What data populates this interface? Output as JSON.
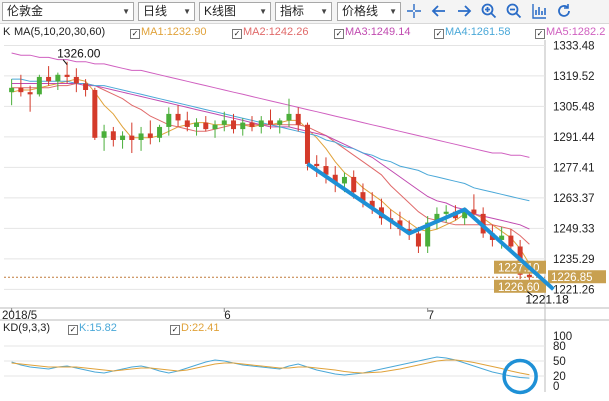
{
  "toolbar": {
    "symbol": "伦敦金",
    "period": "日线",
    "chart_type": "K线图",
    "indicator": "指标",
    "price_line": "价格线",
    "icons": [
      "crosshair-icon",
      "arrow-left-icon",
      "arrow-right-icon",
      "zoom-in-icon",
      "zoom-out-icon",
      "bar-chart-icon",
      "refresh-icon"
    ]
  },
  "ma_legend": {
    "label": "K",
    "params": "MA(5,10,20,30,60)",
    "items": [
      {
        "name": "MA1",
        "value": "1232.90",
        "color": "#e0a23a"
      },
      {
        "name": "MA2",
        "value": "1242.26",
        "color": "#e06a6a"
      },
      {
        "name": "MA3",
        "value": "1249.14",
        "color": "#c04ab0"
      },
      {
        "name": "MA4",
        "value": "1261.58",
        "color": "#4aa8d8"
      },
      {
        "name": "MA5",
        "value": "1282.2",
        "color": "#d060c0"
      }
    ]
  },
  "price_axis": {
    "ticks": [
      "1333.48",
      "1319.52",
      "1305.48",
      "1291.44",
      "1277.41",
      "1263.37",
      "1249.33",
      "1235.29",
      "1221.26"
    ],
    "tick_values": [
      1333.48,
      1319.52,
      1305.48,
      1291.44,
      1277.41,
      1263.37,
      1249.33,
      1235.29,
      1221.26
    ],
    "tags": [
      "1227.10",
      "1226.85",
      "1226.60"
    ],
    "tag_values": [
      1227.1,
      1226.85,
      1226.6
    ]
  },
  "date_axis": {
    "labels": [
      "2018/5",
      "6",
      "7"
    ]
  },
  "annotations": {
    "high": "1326.00",
    "low": "1221.18"
  },
  "kd_legend": {
    "params": "KD(9,3,3)",
    "k_label": "K:15.82",
    "d_label": "D:22.41",
    "k_color": "#4aa8d8",
    "d_color": "#e0a23a"
  },
  "kd_axis": {
    "ticks": [
      "100",
      "80",
      "50",
      "20",
      "0"
    ],
    "tick_values": [
      100,
      80,
      50,
      20,
      0
    ]
  },
  "colors": {
    "up": "#4aae3a",
    "down": "#d43a2a",
    "highlight": "#1e90d6",
    "tag": "#c8a050"
  },
  "chart_data": {
    "type": "candlestick",
    "title": "",
    "ylim": [
      1215,
      1336
    ],
    "x_labels": [
      "2018/5",
      "6",
      "7"
    ],
    "x_label_index": [
      0,
      23,
      45
    ],
    "candles": [
      {
        "o": 1312,
        "h": 1318,
        "l": 1306,
        "c": 1314
      },
      {
        "o": 1314,
        "h": 1320,
        "l": 1310,
        "c": 1312
      },
      {
        "o": 1312,
        "h": 1315,
        "l": 1303,
        "c": 1311
      },
      {
        "o": 1311,
        "h": 1320,
        "l": 1310,
        "c": 1319
      },
      {
        "o": 1319,
        "h": 1324,
        "l": 1315,
        "c": 1317
      },
      {
        "o": 1317,
        "h": 1321,
        "l": 1313,
        "c": 1320
      },
      {
        "o": 1320,
        "h": 1326,
        "l": 1316,
        "c": 1319
      },
      {
        "o": 1319,
        "h": 1323,
        "l": 1312,
        "c": 1316
      },
      {
        "o": 1316,
        "h": 1318,
        "l": 1310,
        "c": 1313
      },
      {
        "o": 1313,
        "h": 1314,
        "l": 1290,
        "c": 1291
      },
      {
        "o": 1291,
        "h": 1297,
        "l": 1285,
        "c": 1294
      },
      {
        "o": 1294,
        "h": 1296,
        "l": 1287,
        "c": 1290
      },
      {
        "o": 1290,
        "h": 1294,
        "l": 1286,
        "c": 1292
      },
      {
        "o": 1292,
        "h": 1298,
        "l": 1284,
        "c": 1290
      },
      {
        "o": 1290,
        "h": 1296,
        "l": 1285,
        "c": 1293
      },
      {
        "o": 1293,
        "h": 1299,
        "l": 1288,
        "c": 1291
      },
      {
        "o": 1291,
        "h": 1297,
        "l": 1289,
        "c": 1296
      },
      {
        "o": 1296,
        "h": 1305,
        "l": 1292,
        "c": 1302
      },
      {
        "o": 1302,
        "h": 1306,
        "l": 1296,
        "c": 1299
      },
      {
        "o": 1299,
        "h": 1303,
        "l": 1294,
        "c": 1296
      },
      {
        "o": 1296,
        "h": 1300,
        "l": 1292,
        "c": 1298
      },
      {
        "o": 1298,
        "h": 1301,
        "l": 1294,
        "c": 1295
      },
      {
        "o": 1295,
        "h": 1299,
        "l": 1291,
        "c": 1297
      },
      {
        "o": 1297,
        "h": 1303,
        "l": 1294,
        "c": 1299
      },
      {
        "o": 1299,
        "h": 1302,
        "l": 1293,
        "c": 1295
      },
      {
        "o": 1295,
        "h": 1300,
        "l": 1292,
        "c": 1298
      },
      {
        "o": 1298,
        "h": 1301,
        "l": 1294,
        "c": 1296
      },
      {
        "o": 1296,
        "h": 1301,
        "l": 1293,
        "c": 1299
      },
      {
        "o": 1299,
        "h": 1304,
        "l": 1295,
        "c": 1297
      },
      {
        "o": 1297,
        "h": 1300,
        "l": 1293,
        "c": 1299
      },
      {
        "o": 1299,
        "h": 1309,
        "l": 1296,
        "c": 1302
      },
      {
        "o": 1302,
        "h": 1305,
        "l": 1294,
        "c": 1297
      },
      {
        "o": 1297,
        "h": 1298,
        "l": 1276,
        "c": 1279
      },
      {
        "o": 1279,
        "h": 1283,
        "l": 1273,
        "c": 1278
      },
      {
        "o": 1278,
        "h": 1282,
        "l": 1270,
        "c": 1274
      },
      {
        "o": 1274,
        "h": 1278,
        "l": 1266,
        "c": 1270
      },
      {
        "o": 1270,
        "h": 1275,
        "l": 1266,
        "c": 1273
      },
      {
        "o": 1273,
        "h": 1276,
        "l": 1263,
        "c": 1266
      },
      {
        "o": 1266,
        "h": 1270,
        "l": 1259,
        "c": 1262
      },
      {
        "o": 1262,
        "h": 1266,
        "l": 1256,
        "c": 1259
      },
      {
        "o": 1259,
        "h": 1263,
        "l": 1251,
        "c": 1254
      },
      {
        "o": 1254,
        "h": 1258,
        "l": 1249,
        "c": 1253
      },
      {
        "o": 1253,
        "h": 1257,
        "l": 1246,
        "c": 1249
      },
      {
        "o": 1249,
        "h": 1253,
        "l": 1244,
        "c": 1247
      },
      {
        "o": 1247,
        "h": 1250,
        "l": 1238,
        "c": 1241
      },
      {
        "o": 1241,
        "h": 1255,
        "l": 1238,
        "c": 1252
      },
      {
        "o": 1252,
        "h": 1259,
        "l": 1249,
        "c": 1256
      },
      {
        "o": 1256,
        "h": 1260,
        "l": 1252,
        "c": 1257
      },
      {
        "o": 1257,
        "h": 1260,
        "l": 1253,
        "c": 1254
      },
      {
        "o": 1254,
        "h": 1259,
        "l": 1251,
        "c": 1258
      },
      {
        "o": 1258,
        "h": 1265,
        "l": 1254,
        "c": 1256
      },
      {
        "o": 1256,
        "h": 1259,
        "l": 1245,
        "c": 1247
      },
      {
        "o": 1247,
        "h": 1251,
        "l": 1241,
        "c": 1244
      },
      {
        "o": 1244,
        "h": 1250,
        "l": 1240,
        "c": 1246
      },
      {
        "o": 1246,
        "h": 1249,
        "l": 1238,
        "c": 1241
      },
      {
        "o": 1241,
        "h": 1244,
        "l": 1226,
        "c": 1228
      },
      {
        "o": 1228,
        "h": 1230,
        "l": 1221.18,
        "c": 1226.85
      }
    ],
    "ma_series": [
      {
        "name": "MA1",
        "color": "#e0a23a",
        "values": [
          1312,
          1313,
          1313,
          1314,
          1315,
          1316,
          1317,
          1318,
          1317,
          1312,
          1306,
          1302,
          1296,
          1291,
          1291,
          1291,
          1292,
          1294,
          1296,
          1297,
          1298,
          1298,
          1297,
          1297,
          1297,
          1297,
          1296,
          1297,
          1297,
          1298,
          1299,
          1299,
          1295,
          1291,
          1286,
          1280,
          1275,
          1272,
          1268,
          1265,
          1262,
          1258,
          1255,
          1252,
          1249,
          1248,
          1249,
          1251,
          1253,
          1256,
          1256,
          1254,
          1251,
          1248,
          1245,
          1240,
          1233
        ]
      },
      {
        "name": "MA2",
        "color": "#e06a6a",
        "values": [
          1314,
          1314,
          1314,
          1314,
          1314,
          1315,
          1315,
          1316,
          1316,
          1315,
          1313,
          1311,
          1309,
          1306,
          1304,
          1301,
          1299,
          1297,
          1296,
          1295,
          1294,
          1294,
          1295,
          1296,
          1297,
          1297,
          1297,
          1297,
          1297,
          1297,
          1297,
          1297,
          1296,
          1294,
          1292,
          1289,
          1286,
          1283,
          1280,
          1277,
          1274,
          1269,
          1265,
          1261,
          1257,
          1254,
          1253,
          1252,
          1251,
          1251,
          1251,
          1251,
          1251,
          1250,
          1249,
          1246,
          1242
        ]
      },
      {
        "name": "MA3",
        "color": "#c04ab0",
        "values": [
          1316,
          1316,
          1316,
          1316,
          1316,
          1316,
          1316,
          1316,
          1315,
          1315,
          1314,
          1313,
          1312,
          1311,
          1310,
          1309,
          1308,
          1307,
          1306,
          1305,
          1304,
          1303,
          1302,
          1301,
          1300,
          1299,
          1298,
          1297,
          1296,
          1296,
          1296,
          1295,
          1294,
          1293,
          1292,
          1290,
          1288,
          1286,
          1284,
          1282,
          1279,
          1276,
          1273,
          1270,
          1267,
          1264,
          1262,
          1261,
          1259,
          1258,
          1256,
          1255,
          1254,
          1253,
          1252,
          1251,
          1249
        ]
      },
      {
        "name": "MA4",
        "color": "#4aa8d8",
        "values": [
          1318,
          1318,
          1317,
          1317,
          1317,
          1317,
          1317,
          1316,
          1316,
          1315,
          1315,
          1314,
          1313,
          1312,
          1311,
          1310,
          1309,
          1308,
          1307,
          1306,
          1305,
          1304,
          1303,
          1302,
          1301,
          1300,
          1299,
          1298,
          1297,
          1296,
          1295,
          1294,
          1293,
          1292,
          1290,
          1289,
          1287,
          1286,
          1284,
          1283,
          1281,
          1280,
          1278,
          1277,
          1276,
          1274,
          1273,
          1272,
          1271,
          1270,
          1268,
          1267,
          1266,
          1265,
          1264,
          1263,
          1262
        ]
      },
      {
        "name": "MA5",
        "color": "#d060c0",
        "values": [
          1330,
          1329,
          1329,
          1328,
          1328,
          1327,
          1327,
          1326,
          1326,
          1325,
          1325,
          1324,
          1323,
          1322,
          1322,
          1321,
          1320,
          1319,
          1318,
          1317,
          1316,
          1315,
          1314,
          1313,
          1312,
          1311,
          1310,
          1309,
          1308,
          1307,
          1306,
          1305,
          1304,
          1303,
          1302,
          1301,
          1300,
          1299,
          1298,
          1297,
          1296,
          1295,
          1294,
          1293,
          1292,
          1291,
          1290,
          1289,
          1288,
          1287,
          1286,
          1285,
          1284,
          1284,
          1283,
          1283,
          1282
        ]
      }
    ],
    "kd": {
      "k": [
        48,
        42,
        38,
        36,
        34,
        38,
        40,
        36,
        32,
        28,
        26,
        30,
        34,
        38,
        40,
        36,
        30,
        26,
        30,
        36,
        42,
        48,
        52,
        50,
        46,
        42,
        40,
        38,
        36,
        34,
        40,
        44,
        38,
        32,
        28,
        24,
        22,
        24,
        26,
        30,
        34,
        38,
        42,
        46,
        50,
        54,
        58,
        56,
        52,
        46,
        40,
        34,
        28,
        24,
        20,
        17,
        15.82
      ],
      "d": [
        46,
        44,
        42,
        40,
        38,
        38,
        38,
        38,
        36,
        34,
        32,
        30,
        32,
        34,
        36,
        36,
        34,
        32,
        30,
        32,
        36,
        40,
        44,
        46,
        46,
        44,
        42,
        40,
        38,
        36,
        36,
        38,
        38,
        36,
        34,
        32,
        29,
        27,
        26,
        27,
        28,
        31,
        34,
        38,
        42,
        46,
        50,
        52,
        52,
        50,
        47,
        43,
        39,
        35,
        30,
        26,
        22.41
      ]
    },
    "highlight_zigzag": [
      {
        "i": 32,
        "p": 1279
      },
      {
        "i": 43,
        "p": 1247
      },
      {
        "i": 49,
        "p": 1258
      },
      {
        "i": 56,
        "p": 1226.85
      }
    ],
    "grid": true
  }
}
